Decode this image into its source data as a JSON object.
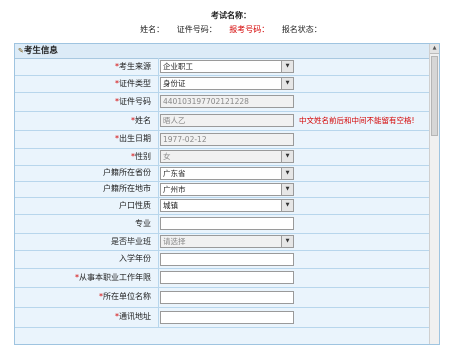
{
  "header": {
    "exam_name_label": "考试名称：",
    "name_label": "姓名：",
    "id_label": "证件号码：",
    "reg_no_label": "报考号码：",
    "reg_status_label": "报名状态："
  },
  "panel": {
    "title": "考生信息"
  },
  "fields": [
    {
      "label": "考生来源",
      "required": true,
      "type": "select",
      "value": "企业职工"
    },
    {
      "label": "证件类型",
      "required": true,
      "type": "select",
      "value": "身份证"
    },
    {
      "label": "证件号码",
      "required": true,
      "type": "input",
      "value": "440103197702121228",
      "disabled": true
    },
    {
      "label": "姓名",
      "required": true,
      "type": "input",
      "value": "晤人乙",
      "disabled": true,
      "note": "中文姓名前后和中间不能留有空格!"
    },
    {
      "label": "出生日期",
      "required": true,
      "type": "input",
      "value": "1977-02-12",
      "disabled": true
    },
    {
      "label": "性别",
      "required": true,
      "type": "select",
      "value": "女",
      "disabled": true
    },
    {
      "label": "户籍所在省份",
      "required": false,
      "type": "select",
      "value": "广东省"
    },
    {
      "label": "户籍所在地市",
      "required": false,
      "type": "select",
      "value": "广州市"
    },
    {
      "label": "户口性质",
      "required": false,
      "type": "select",
      "value": "城镇"
    },
    {
      "label": "专业",
      "required": false,
      "type": "input",
      "value": ""
    },
    {
      "label": "是否毕业班",
      "required": false,
      "type": "select",
      "value": "请选择",
      "disabled": true
    },
    {
      "label": "入学年份",
      "required": false,
      "type": "input",
      "value": ""
    },
    {
      "label": "从事本职业工作年限",
      "required": true,
      "type": "input",
      "value": ""
    },
    {
      "label": "所在单位名称",
      "required": true,
      "type": "input",
      "value": ""
    },
    {
      "label": "通讯地址",
      "required": true,
      "type": "input",
      "value": ""
    }
  ],
  "icons": {
    "pencil": "pencil-icon",
    "dropdown": "dropdown-arrow-icon",
    "scroll_up": "scroll-up-arrow-icon"
  }
}
